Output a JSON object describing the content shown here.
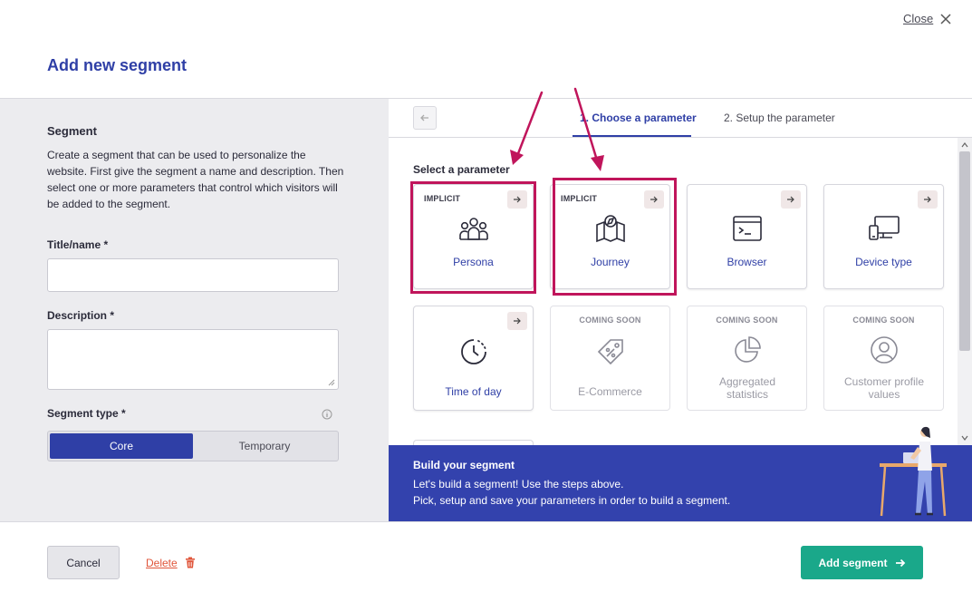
{
  "header": {
    "close_label": "Close",
    "title": "Add new segment"
  },
  "left_panel": {
    "heading": "Segment",
    "description": "Create a segment that can be used to personalize the website. First give the segment a name and description. Then select one or more parameters that control which visitors will be added to the segment.",
    "title_label": "Title/name *",
    "title_value": "",
    "description_label": "Description *",
    "description_value": "",
    "segment_type_label": "Segment type *",
    "segment_type_options": [
      "Core",
      "Temporary"
    ],
    "segment_type_selected": "Core"
  },
  "wizard": {
    "tabs": [
      {
        "label": "1. Choose a parameter",
        "active": true
      },
      {
        "label": "2. Setup the parameter",
        "active": false
      }
    ],
    "select_label": "Select a parameter",
    "cards": [
      {
        "tag": "IMPLICIT",
        "label": "Persona",
        "icon": "people-icon",
        "enabled": true
      },
      {
        "tag": "IMPLICIT",
        "label": "Journey",
        "icon": "map-compass-icon",
        "enabled": true
      },
      {
        "tag": "",
        "label": "Browser",
        "icon": "terminal-window-icon",
        "enabled": true
      },
      {
        "tag": "",
        "label": "Device type",
        "icon": "devices-icon",
        "enabled": true
      },
      {
        "tag": "",
        "label": "Time of day",
        "icon": "clock-icon",
        "enabled": true
      },
      {
        "tag": "COMING SOON",
        "label": "E-Commerce",
        "icon": "price-tag-icon",
        "enabled": false
      },
      {
        "tag": "COMING SOON",
        "label": "Aggregated statistics",
        "icon": "pie-chart-icon",
        "enabled": false
      },
      {
        "tag": "COMING SOON",
        "label": "Customer profile values",
        "icon": "user-circle-icon",
        "enabled": false
      }
    ]
  },
  "banner": {
    "title": "Build your segment",
    "line1": "Let's build a segment! Use the steps above.",
    "line2": "Pick, setup and save your parameters in order to build a segment."
  },
  "footer": {
    "cancel_label": "Cancel",
    "delete_label": "Delete",
    "add_label": "Add segment"
  },
  "colors": {
    "brand_blue": "#2f3fa6",
    "banner_blue": "#3342ad",
    "add_green": "#1aa88a",
    "delete_red": "#e0553a",
    "highlight_magenta": "#c0155b"
  }
}
